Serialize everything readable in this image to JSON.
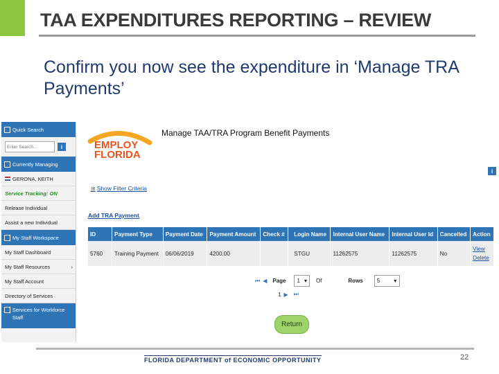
{
  "slide": {
    "title": "TAA EXPENDITURES REPORTING – REVIEW",
    "subtitle": "Confirm you now see the expenditure in ‘Manage TRA Payments’",
    "footer": "FLORIDA DEPARTMENT of ECONOMIC OPPORTUNITY",
    "page_number": "22",
    "accent_color": "#8dc63f"
  },
  "sidebar": {
    "quick_search_label": "Quick Search",
    "search_placeholder": "Enter Search...",
    "currently_managing_label": "Currently Managing",
    "managed_individual": "GERONA, KEITH",
    "service_tracking": "Service Tracking: ON",
    "release_individual": "Release Individual",
    "assist_new_individual": "Assist a new Individual",
    "workspace_label": "My Staff Workspace",
    "workspace_items": [
      "My Staff Dashboard",
      "My Staff Resources",
      "My Staff Account",
      "Directory of Services"
    ],
    "services_label": "Services for Workforce Staff"
  },
  "app": {
    "logo_line1": "EMPLOY",
    "logo_line2": "FLORIDA",
    "panel_title": "Manage TAA/TRA Program Benefit Payments",
    "show_filter": "Show Filter Criteria",
    "add_payment": "Add TRA Payment",
    "table": {
      "headers": [
        "ID",
        "Payment Type",
        "Payment Date",
        "Payment Amount",
        "Check #",
        "Login Name",
        "Internal User Name",
        "Internal User Id",
        "Cancelled",
        "Action"
      ],
      "row": {
        "id": "5760",
        "payment_type": "Training Payment",
        "payment_date": "06/06/2019",
        "amount": "4200.00",
        "check": "",
        "login": "STGU",
        "internal_name": "11262575",
        "internal_id": "11262575",
        "cancelled": "No",
        "action_view": "View",
        "action_delete": "Delete"
      }
    },
    "pager": {
      "page_label": "Page",
      "page_value": "1",
      "of_label": "Of",
      "rows_label": "Rows",
      "rows_value": "5",
      "page_number": "1"
    },
    "return_label": "Return"
  }
}
